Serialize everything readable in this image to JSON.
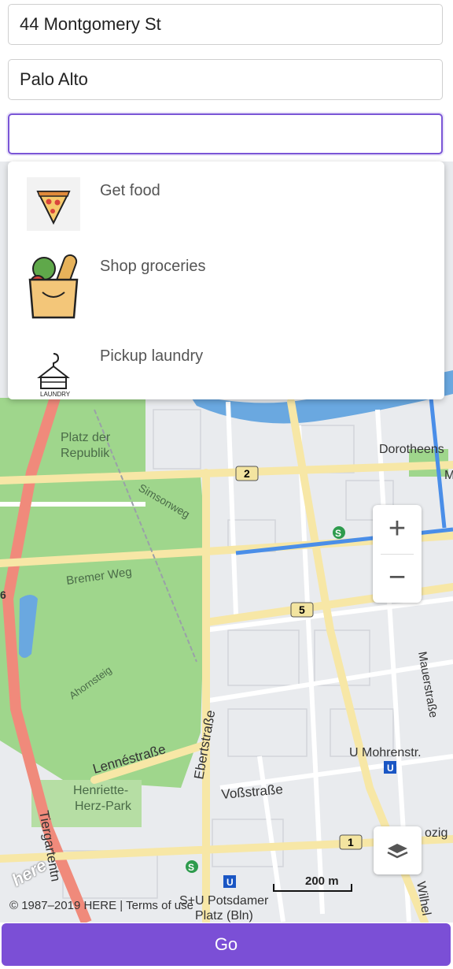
{
  "form": {
    "from_value": "44 Montgomery St",
    "to_value": "Palo Alto",
    "errand_value": "",
    "errand_placeholder": ""
  },
  "suggestions": [
    {
      "label": "Get food",
      "icon": "pizza-icon"
    },
    {
      "label": "Shop groceries",
      "icon": "grocery-bag-icon"
    },
    {
      "label": "Pickup laundry",
      "icon": "laundry-icon"
    }
  ],
  "laundry_icon_text": "LAUNDRY",
  "map": {
    "labels": {
      "platz_der": "Platz der",
      "republik": "Republik",
      "simsonweg": "Simsonweg",
      "bremer_weg": "Bremer Weg",
      "ahornsteig": "Ahornsteig",
      "lennestrasse": "Lennéstraße",
      "ebertstrasse": "Ebertstraße",
      "henriette": "Henriette-",
      "herz_park": "Herz-Park",
      "vossstrasse": "Voßstraße",
      "tiergartentunnel": "Tiergartentn",
      "mauerstrasse": "Mauerstraße",
      "u_mohrenstr": "U Mohrenstr.",
      "dorotheen": "Dorotheens",
      "wilhelm": "Wilhel",
      "potsdamer": "S+U Potsdamer",
      "platz_bln": "Platz (Bln)",
      "zig": "ozig",
      "m": "M",
      "route_2": "2",
      "route_5": "5",
      "route_1": "1",
      "num_6": "6"
    },
    "zoom_in": "+",
    "zoom_out": "−",
    "scale": "200 m",
    "copyright": "© 1987–2019 HERE | Terms of use",
    "logo": "here",
    "colors": {
      "route": "#4a8ee8",
      "park": "#9fd68c",
      "water": "#6aa8e0",
      "highway": "#f08a7b",
      "main_road": "#f7e7a6"
    }
  },
  "go_button": "Go",
  "accent": "#7b4fd6"
}
